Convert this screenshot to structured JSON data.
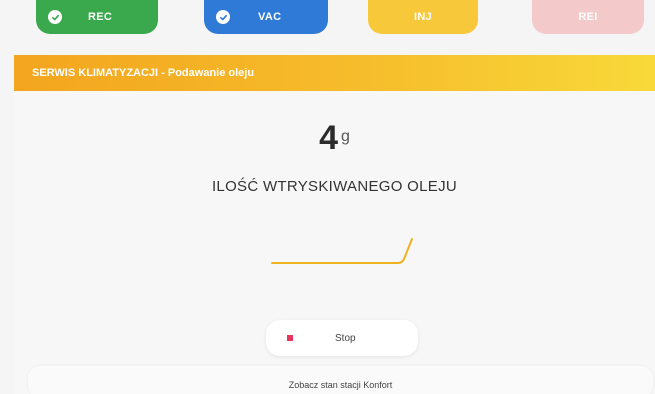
{
  "steps": [
    {
      "label": "REC",
      "status": "done",
      "color": "#3aa84c"
    },
    {
      "label": "VAC",
      "status": "done",
      "color": "#2f7ad6"
    },
    {
      "label": "INJ",
      "status": "active",
      "color": "#f7c93a"
    },
    {
      "label": "REI",
      "status": "pending",
      "color": "#f3c9c9"
    }
  ],
  "header": {
    "title": "SERWIS KLIMATYZACJI - Podawanie oleju",
    "color": "#f3a51f"
  },
  "reading": {
    "value": "4",
    "unit": "g",
    "label": "ILOŚĆ WTRYSKIWANEGO OLEJU"
  },
  "actions": {
    "stop_label": "Stop",
    "stop_icon": "stop-square-icon",
    "stop_icon_color": "#e8355e"
  },
  "footer": {
    "link_label": "Zobacz stan stacji Konfort"
  }
}
